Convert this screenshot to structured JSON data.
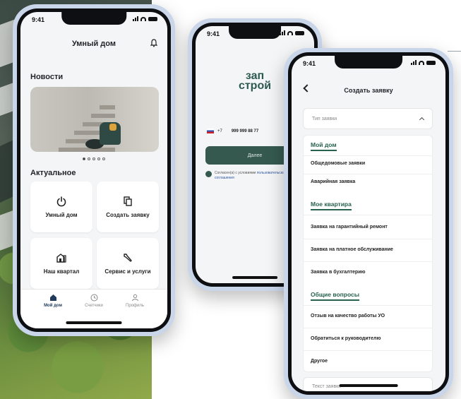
{
  "phone1": {
    "time": "9:41",
    "title": "Умный дом",
    "news_heading": "Новости",
    "actual_heading": "Актуальное",
    "tiles": [
      {
        "label": "Умный дом",
        "icon": "power-icon"
      },
      {
        "label": "Создать заявку",
        "icon": "document-copy-icon"
      },
      {
        "label": "Наш квартал",
        "icon": "building-icon"
      },
      {
        "label": "Сервис и услуги",
        "icon": "wrench-icon"
      }
    ],
    "tabs": [
      {
        "label": "Мой дом",
        "icon": "home-icon",
        "active": true
      },
      {
        "label": "Счетчики",
        "icon": "clock-icon",
        "active": false
      },
      {
        "label": "Профиль",
        "icon": "user-icon",
        "active": false
      }
    ]
  },
  "phone2": {
    "time": "9:41",
    "logo": "зап строй",
    "logo_line1": "зап",
    "logo_line2": "строй",
    "country_code": "+7",
    "phone_number": "999 999 88 77",
    "next_label": "Далее",
    "agree_text": "Согласен(а) с условиями",
    "agree_link": "пользовательского соглашения"
  },
  "phone3": {
    "time": "9:41",
    "title": "Создать заявку",
    "type_placeholder": "Тип заявки",
    "groups": [
      {
        "heading": "Мой дом",
        "items": [
          "Общедомовые заявки",
          "Аварийная заявка"
        ]
      },
      {
        "heading": "Мое квартира",
        "items": [
          "Заявка на гарантийный ремонт",
          "Заявка на платное обслуживание",
          "Заявка в бухгалтерию"
        ]
      },
      {
        "heading": "Общие вопросы",
        "items": [
          "Отзыв на качество работы УО",
          "Обратиться к руководителю",
          "Другое"
        ]
      }
    ],
    "text_placeholder": "Текст заявки"
  },
  "colors": {
    "brand_green": "#35594f",
    "heading_green": "#27614f",
    "phone_frame": "#c9d6ea"
  }
}
